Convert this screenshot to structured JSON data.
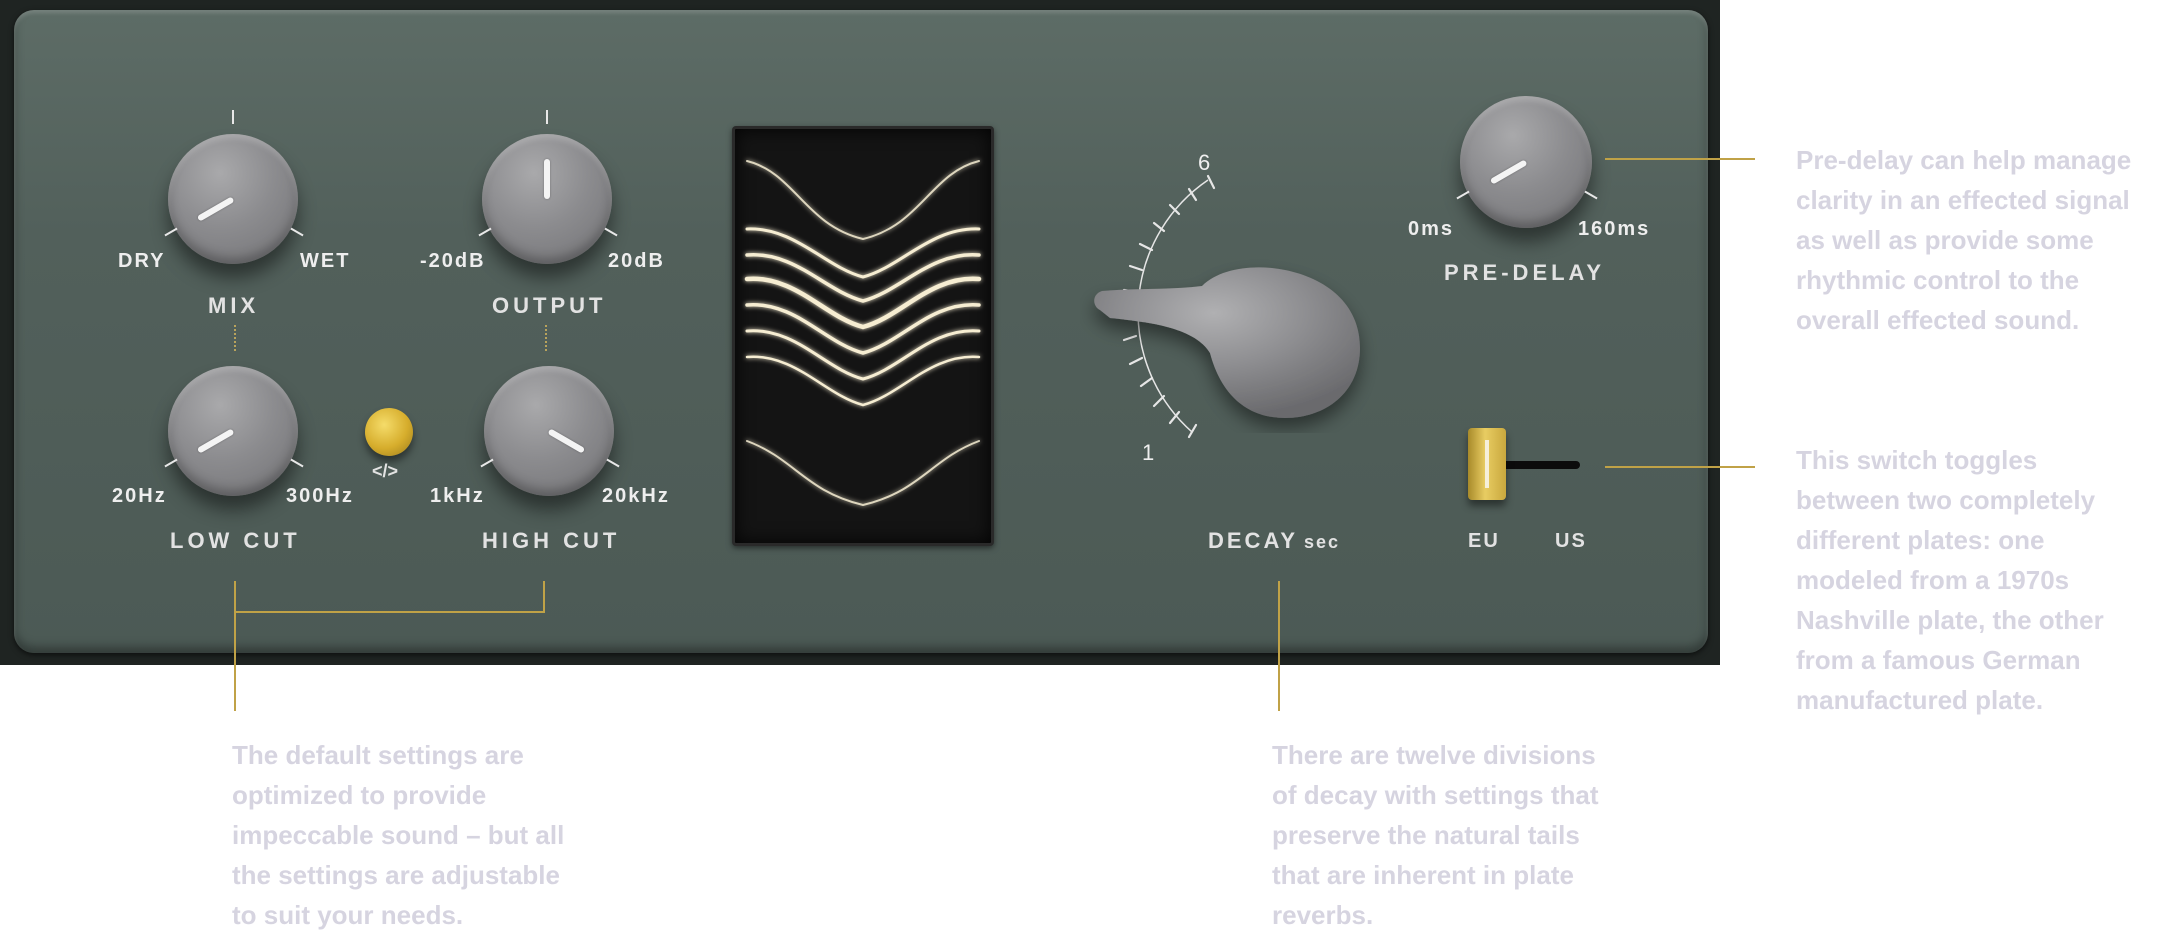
{
  "knobs": {
    "mix": {
      "label": "MIX",
      "min_label": "DRY",
      "max_label": "WET"
    },
    "output": {
      "label": "OUTPUT",
      "min_label": "-20dB",
      "max_label": "20dB"
    },
    "low_cut": {
      "label": "LOW CUT",
      "min_label": "20Hz",
      "max_label": "300Hz"
    },
    "high_cut": {
      "label": "HIGH CUT",
      "min_label": "1kHz",
      "max_label": "20kHz"
    },
    "pre_delay": {
      "label": "PRE-DELAY",
      "min_label": "0ms",
      "max_label": "160ms"
    }
  },
  "link_icon": "</>",
  "decay": {
    "label_main": "DECAY",
    "label_unit": "sec",
    "scale_min": "1",
    "scale_max": "6"
  },
  "switch": {
    "left_label": "EU",
    "right_label": "US"
  },
  "notes": {
    "pre_delay": [
      "Pre-delay can help manage",
      "clarity in an effected signal",
      "as well as provide some",
      "rhythmic control to the",
      "overall effected sound."
    ],
    "switch": [
      "This switch toggles",
      "between two completely",
      "different plates: one",
      "modeled from a 1970s",
      "Nashville plate, the other",
      "from a famous German",
      "manufactured plate."
    ],
    "default": [
      "The default settings are",
      "optimized to provide",
      "impeccable sound – but all",
      "the settings are adjustable",
      "to suit your needs."
    ],
    "decay": [
      "There are twelve divisions",
      "of decay with settings that",
      "preserve the natural tails",
      "that are inherent in plate",
      "reverbs."
    ]
  },
  "colors": {
    "panel": "#56645f",
    "accent_gold": "#c0a247",
    "note_text": "#d6d4e0",
    "knob": "#8c8c8f"
  }
}
